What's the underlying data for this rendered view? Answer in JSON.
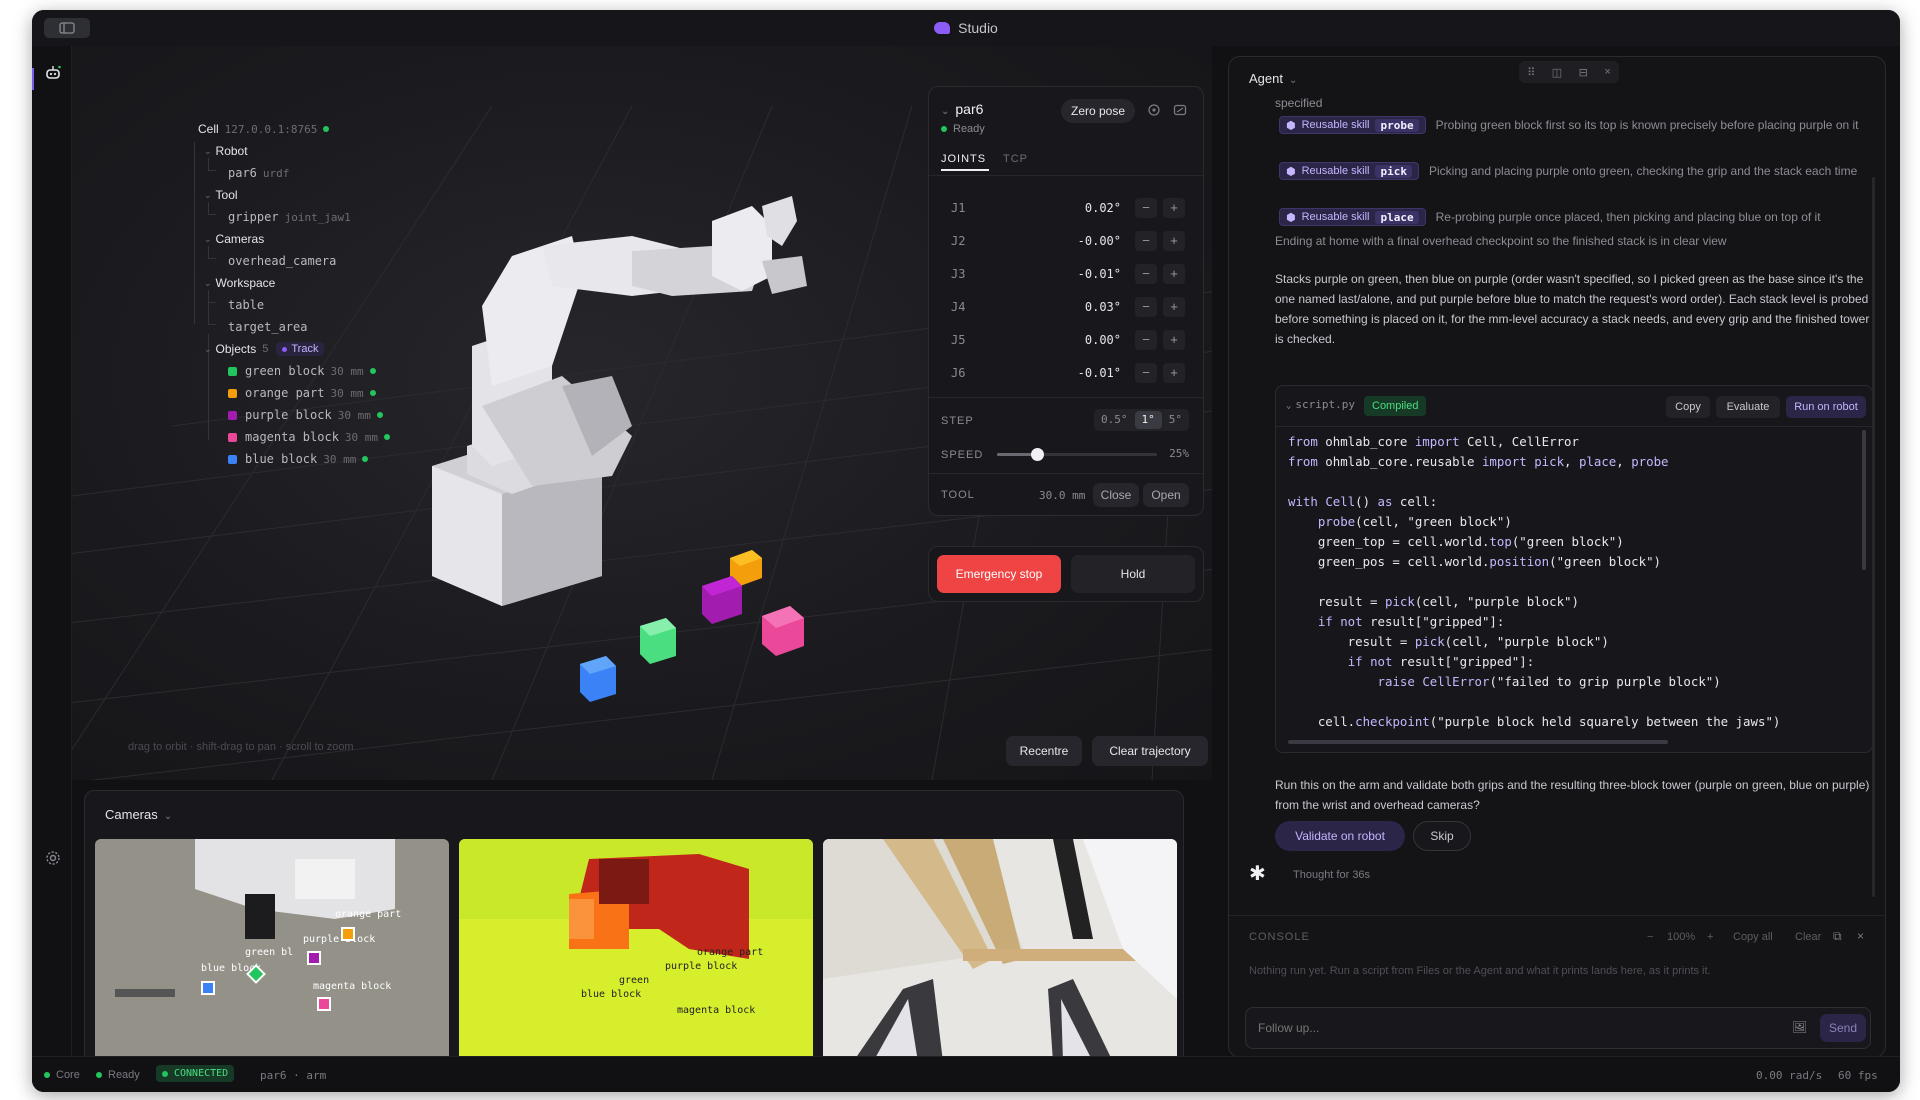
{
  "window": {
    "title": "Studio"
  },
  "tree": {
    "cell_label": "Cell",
    "cell_address": "127.0.0.1:8765",
    "robot_label": "Robot",
    "robot_item": "par6",
    "robot_item_sub": "urdf",
    "tool_label": "Tool",
    "tool_item": "gripper",
    "tool_item_sub": "joint_jaw1",
    "cameras_label": "Cameras",
    "camera_item": "overhead_camera",
    "workspace_label": "Workspace",
    "workspace_items": [
      "table",
      "target_area"
    ],
    "objects_label": "Objects",
    "objects_count": "5",
    "track_label": "Track",
    "objects": [
      {
        "name": "green block",
        "size": "30 mm",
        "color": "#22c55e"
      },
      {
        "name": "orange part",
        "size": "30 mm",
        "color": "#f59e0b"
      },
      {
        "name": "purple block",
        "size": "30 mm",
        "color": "#a21caf"
      },
      {
        "name": "magenta block",
        "size": "30 mm",
        "color": "#ec4899"
      },
      {
        "name": "blue block",
        "size": "30 mm",
        "color": "#3b82f6"
      }
    ]
  },
  "viewport": {
    "hint": "drag to orbit · shift-drag to pan · scroll to zoom",
    "recentre": "Recentre",
    "clear_trajectory": "Clear trajectory"
  },
  "jog": {
    "robot": "par6",
    "status": "Ready",
    "zero_pose": "Zero pose",
    "tab_joints": "JOINTS",
    "tab_tcp": "TCP",
    "joints": [
      {
        "name": "J1",
        "value": "0.02°"
      },
      {
        "name": "J2",
        "value": "-0.00°"
      },
      {
        "name": "J3",
        "value": "-0.01°"
      },
      {
        "name": "J4",
        "value": "0.03°"
      },
      {
        "name": "J5",
        "value": "0.00°"
      },
      {
        "name": "J6",
        "value": "-0.01°"
      }
    ],
    "minus": "−",
    "plus": "+",
    "step_label": "STEP",
    "steps": [
      "0.5°",
      "1°",
      "5°"
    ],
    "speed_label": "SPEED",
    "speed_value": "25%",
    "speed_fraction": 0.25,
    "tool_label": "TOOL",
    "tool_value": "30.0 mm",
    "tool_close": "Close",
    "tool_open": "Open",
    "estop": "Emergency stop",
    "hold": "Hold"
  },
  "cameras": {
    "title": "Cameras",
    "cam1_labels": [
      "orange part",
      "purple block",
      "green bl",
      "blue block",
      "magenta block"
    ],
    "cam2_labels": [
      "orange part",
      "purple block",
      "green",
      "blue block",
      "magenta block"
    ]
  },
  "agent": {
    "title": "Agent",
    "specified": "specified",
    "skill_badge": "Reusable skill",
    "skills": [
      {
        "key": "probe",
        "desc": "Probing green block first so its top is known precisely before placing purple on it"
      },
      {
        "key": "pick",
        "desc": "Picking and placing purple onto green, checking the grip and the stack each time"
      },
      {
        "key": "place",
        "desc": "Re-probing purple once placed, then picking and placing blue on top of it"
      }
    ],
    "ending": "Ending at home with a final overhead checkpoint so the finished stack is in clear view",
    "summary": "Stacks purple on green, then blue on purple (order wasn't specified, so I picked green as the base since it's the one named last/alone, and put purple before blue to match the request's word order). Each stack level is probed before something is placed on it, for the mm-level accuracy a stack needs, and every grip and the finished tower is checked.",
    "file": "script.py",
    "compiled": "Compiled",
    "copy": "Copy",
    "evaluate": "Evaluate",
    "run_on_robot": "Run on robot",
    "question": "Run this on the arm and validate both grips and the resulting three-block tower (purple on green, blue on purple) from the wrist and overhead cameras?",
    "validate": "Validate on robot",
    "skip": "Skip",
    "thought": "Thought for 36s"
  },
  "console": {
    "title": "CONSOLE",
    "zoom": "100%",
    "zoom_minus": "−",
    "zoom_plus": "+",
    "copy_all": "Copy all",
    "clear": "Clear",
    "empty": "Nothing run yet. Run a script from Files or the Agent and what it prints lands here, as it prints it."
  },
  "composer": {
    "placeholder": "Follow up...",
    "send": "Send"
  },
  "status": {
    "core": "Core",
    "ready": "Ready",
    "connected": "CONNECTED",
    "robot": "par6 · arm",
    "rate": "0.00 rad/s",
    "fps": "60 fps"
  }
}
